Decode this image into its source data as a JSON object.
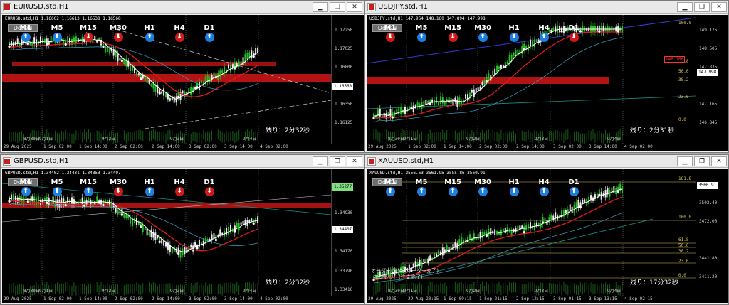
{
  "windows": [
    {
      "id": "eurusd",
      "title": "EURUSD.std,H1",
      "symbol_line": "EURUSD.std,H1  1.16602 1.16613 1.16538 1.16568",
      "dot_label": "DotON",
      "timer": "残り：2分32秒",
      "current_price": "1.16568",
      "price_ticks": [
        "1.17250",
        "1.17025",
        "1.16800",
        "1.16350",
        "1.16125"
      ],
      "date_labels": [
        "8月30日",
        "9月1日",
        "9月2日",
        "9月3日",
        "9月4日"
      ],
      "time_labels": [
        "29 Aug 2025",
        "1 Sep 02:00",
        "1 Sep 14:00",
        "2 Sep 02:00",
        "2 Sep 14:00",
        "3 Sep 02:00",
        "3 Sep 14:00",
        "4 Sep 02:00"
      ],
      "timeframes": [
        {
          "label": "M1",
          "dir": "up"
        },
        {
          "label": "M5",
          "dir": "up"
        },
        {
          "label": "M15",
          "dir": "down"
        },
        {
          "label": "M30",
          "dir": "down"
        },
        {
          "label": "H1",
          "dir": "up"
        },
        {
          "label": "H4",
          "dir": "down"
        },
        {
          "label": "D1",
          "dir": "up"
        }
      ]
    },
    {
      "id": "usdjpy",
      "title": "USDJPY.std,H1",
      "symbol_line": "USDJPY.std,H1  147.964 148.160 147.894 147.998",
      "dot_label": "DotON",
      "timer": "残り：2分31秒",
      "current_price": "147.998",
      "red_price": "148.260",
      "price_ticks": [
        "149.175",
        "148.505",
        "147.835",
        "147.165",
        "146.845"
      ],
      "fib_levels": [
        "100.0",
        "61.8",
        "50.0",
        "38.2",
        "23.6",
        "0.0"
      ],
      "date_labels": [
        "8月30日",
        "9月1日",
        "9月2日",
        "9月3日",
        "9月4日"
      ],
      "time_labels": [
        "29 Aug 2025",
        "1 Sep 02:00",
        "1 Sep 14:00",
        "2 Sep 02:00",
        "2 Sep 14:00",
        "3 Sep 02:00",
        "3 Sep 14:00",
        "4 Sep 02:00"
      ],
      "timeframes": [
        {
          "label": "M1",
          "dir": "down"
        },
        {
          "label": "M5",
          "dir": "up"
        },
        {
          "label": "M15",
          "dir": "down"
        },
        {
          "label": "M30",
          "dir": "up"
        },
        {
          "label": "H1",
          "dir": "up"
        },
        {
          "label": "H4",
          "dir": "up"
        },
        {
          "label": "D1",
          "dir": "down"
        }
      ]
    },
    {
      "id": "gbpusd",
      "title": "GBPUSD.std,H1",
      "symbol_line": "GBPUSD.std,H1  1.34402 1.34431 1.34353 1.34407",
      "dot_label": "DotON",
      "timer": "残り：2分32秒",
      "current_price": "1.34407",
      "green_price": "1.35277",
      "price_ticks": [
        "1.34930",
        "1.34170",
        "1.33790",
        "1.33410"
      ],
      "date_labels": [
        "8月30日",
        "9月1日",
        "9月2日",
        "9月3日",
        "9月4日"
      ],
      "time_labels": [
        "29 Aug 2025",
        "1 Sep 02:00",
        "1 Sep 14:00",
        "2 Sep 02:00",
        "2 Sep 14:00",
        "3 Sep 02:00",
        "3 Sep 14:00",
        "4 Sep 02:00"
      ],
      "timeframes": [
        {
          "label": "M1",
          "dir": "up"
        },
        {
          "label": "M5",
          "dir": "up"
        },
        {
          "label": "M15",
          "dir": "up"
        },
        {
          "label": "M30",
          "dir": "down"
        },
        {
          "label": "H1",
          "dir": "up"
        },
        {
          "label": "H4",
          "dir": "down"
        },
        {
          "label": "D1",
          "dir": "down"
        }
      ]
    },
    {
      "id": "xauusd",
      "title": "XAUUSD.std,H1",
      "symbol_line": "XAUUSD.std,H1  3556.63 3561.95 3555.86 3560.91",
      "dot_label": "DotON",
      "timer": "残り：17分32秒",
      "current_price": "3560.91",
      "price_ticks": [
        "3533.00",
        "3502.40",
        "3472.00",
        "3441.80",
        "3411.20"
      ],
      "fib_levels": [
        "161.8",
        "100.0",
        "61.8",
        "50.0",
        "38.2",
        "23.6",
        "0.0"
      ],
      "annotation_1": "オーダー(決済)(オーダー完了)",
      "annotation_2": "エントリー(注文完了)",
      "date_labels": [
        "8月30日",
        "9月1日",
        "9月2日",
        "9月3日",
        "9月4日"
      ],
      "time_labels": [
        "29 Aug 2025",
        "29 Aug 20:15",
        "1 Sep 09:15",
        "1 Sep 21:15",
        "2 Sep 12:15",
        "3 Sep 01:15",
        "3 Sep 13:15",
        "4 Sep 02:15"
      ],
      "timeframes": [
        {
          "label": "M1",
          "dir": "up"
        },
        {
          "label": "M5",
          "dir": "up"
        },
        {
          "label": "M15",
          "dir": "up"
        },
        {
          "label": "M30",
          "dir": "up"
        },
        {
          "label": "H1",
          "dir": "up"
        },
        {
          "label": "H4",
          "dir": "up"
        },
        {
          "label": "D1",
          "dir": "up"
        }
      ]
    }
  ],
  "buttons": {
    "minimize": "▁",
    "restore": "❐",
    "close": "✕"
  },
  "colors": {
    "up_arrow": "#1a7fe0",
    "down_arrow": "#d11919",
    "resistance_zone": "#b31313",
    "ma_red": "#e01b1b",
    "ma_white": "#ffffff",
    "bull_candle": "#22c022",
    "fib": "#d9c35a"
  }
}
